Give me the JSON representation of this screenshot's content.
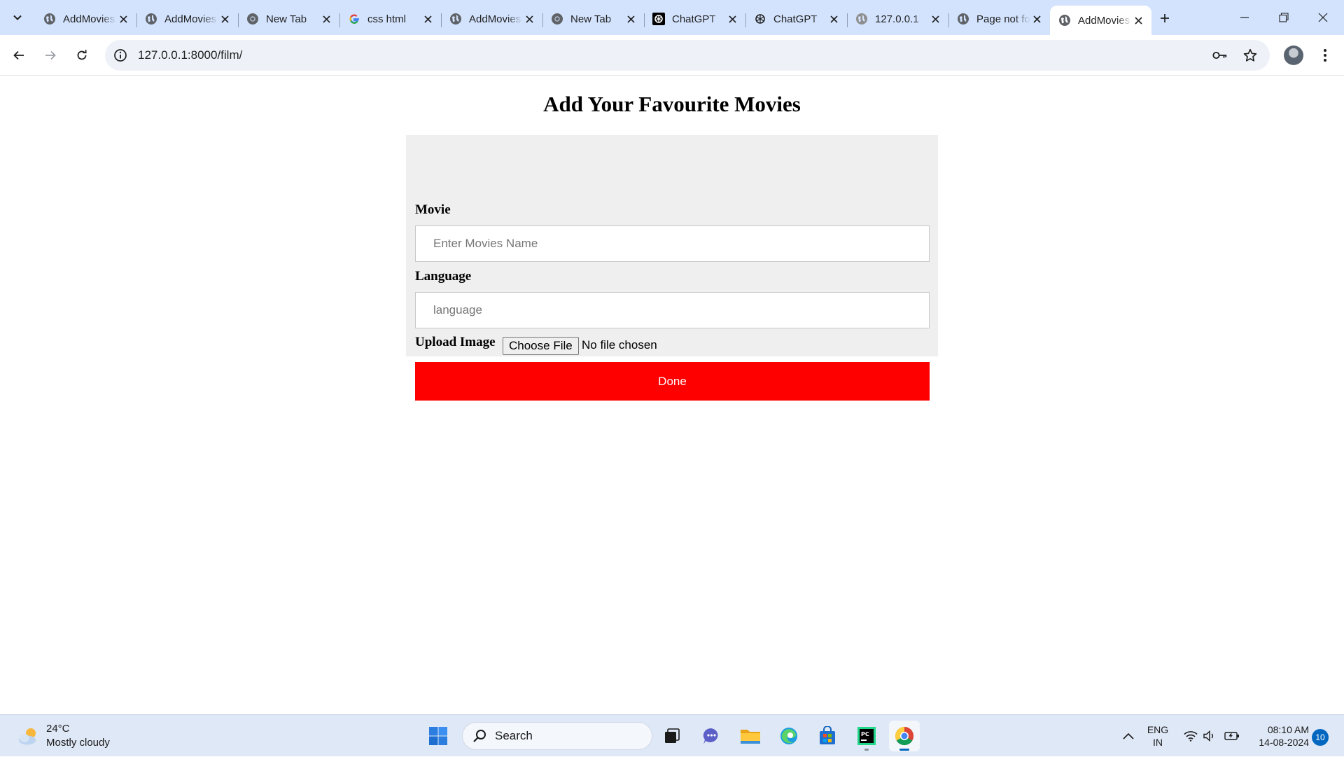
{
  "browser": {
    "tabs": [
      {
        "label": "AddMovies",
        "icon": "globe-icon",
        "active": false
      },
      {
        "label": "AddMovies",
        "icon": "globe-icon",
        "active": false
      },
      {
        "label": "New Tab",
        "icon": "chrome-icon",
        "active": false
      },
      {
        "label": "css html",
        "icon": "google-icon",
        "active": false
      },
      {
        "label": "AddMovies",
        "icon": "globe-icon",
        "active": false
      },
      {
        "label": "New Tab",
        "icon": "chrome-icon",
        "active": false
      },
      {
        "label": "ChatGPT",
        "icon": "chatgpt-icon",
        "active": false
      },
      {
        "label": "ChatGPT",
        "icon": "chatgpt-icon",
        "active": false
      },
      {
        "label": "127.0.0.1",
        "icon": "globe-icon",
        "active": false
      },
      {
        "label": "Page not found",
        "icon": "globe-icon",
        "active": false
      },
      {
        "label": "AddMovies",
        "icon": "globe-icon",
        "active": true
      }
    ],
    "url": "127.0.0.1:8000/film/"
  },
  "page": {
    "title": "Add Your Favourite Movies",
    "form": {
      "movie_label": "Movie",
      "movie_placeholder": "Enter Movies Name",
      "language_label": "Language",
      "language_placeholder": "language",
      "upload_label": "Upload Image",
      "choose_file_label": "Choose File",
      "file_status": "No file chosen",
      "submit_label": "Done",
      "submit_color": "#ff0000",
      "panel_color": "#efefef"
    }
  },
  "taskbar": {
    "weather": {
      "temp": "24°C",
      "condition": "Mostly cloudy"
    },
    "search_label": "Search",
    "apps": [
      "windows-start-icon",
      "task-view-icon",
      "teams-chat-icon",
      "file-explorer-icon",
      "edge-icon",
      "microsoft-store-icon",
      "pycharm-icon",
      "chrome-icon"
    ],
    "language": {
      "line1": "ENG",
      "line2": "IN"
    },
    "clock": {
      "time": "08:10 AM",
      "date": "14-08-2024"
    },
    "notifications": "10"
  },
  "colors": {
    "tabstrip": "#d3e3fd",
    "omnibox": "#eef2f8",
    "taskbar": "#dfe8f6",
    "accent": "#0067c0"
  }
}
